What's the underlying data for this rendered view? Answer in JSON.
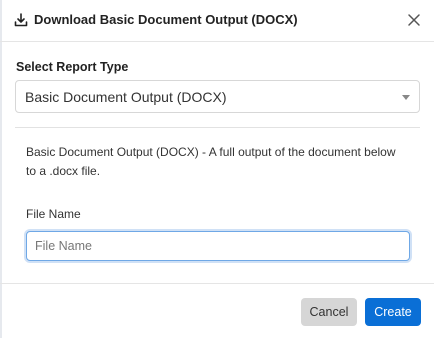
{
  "dialog": {
    "title": "Download Basic Document Output (DOCX)",
    "header_icon": "download-icon",
    "close_icon": "close-icon"
  },
  "report_type": {
    "label": "Select Report Type",
    "selected": "Basic Document Output (DOCX)",
    "caret_icon": "chevron-down-icon"
  },
  "description": "Basic Document Output (DOCX)  -  A full output of the document below to a .docx file.",
  "file_name": {
    "label": "File Name",
    "value": "",
    "placeholder": "File Name"
  },
  "footer": {
    "cancel_label": "Cancel",
    "create_label": "Create"
  },
  "colors": {
    "primary": "#0a6fd6",
    "cancel_bg": "#d6d6d6",
    "input_focus_border": "#6fa8e6"
  }
}
